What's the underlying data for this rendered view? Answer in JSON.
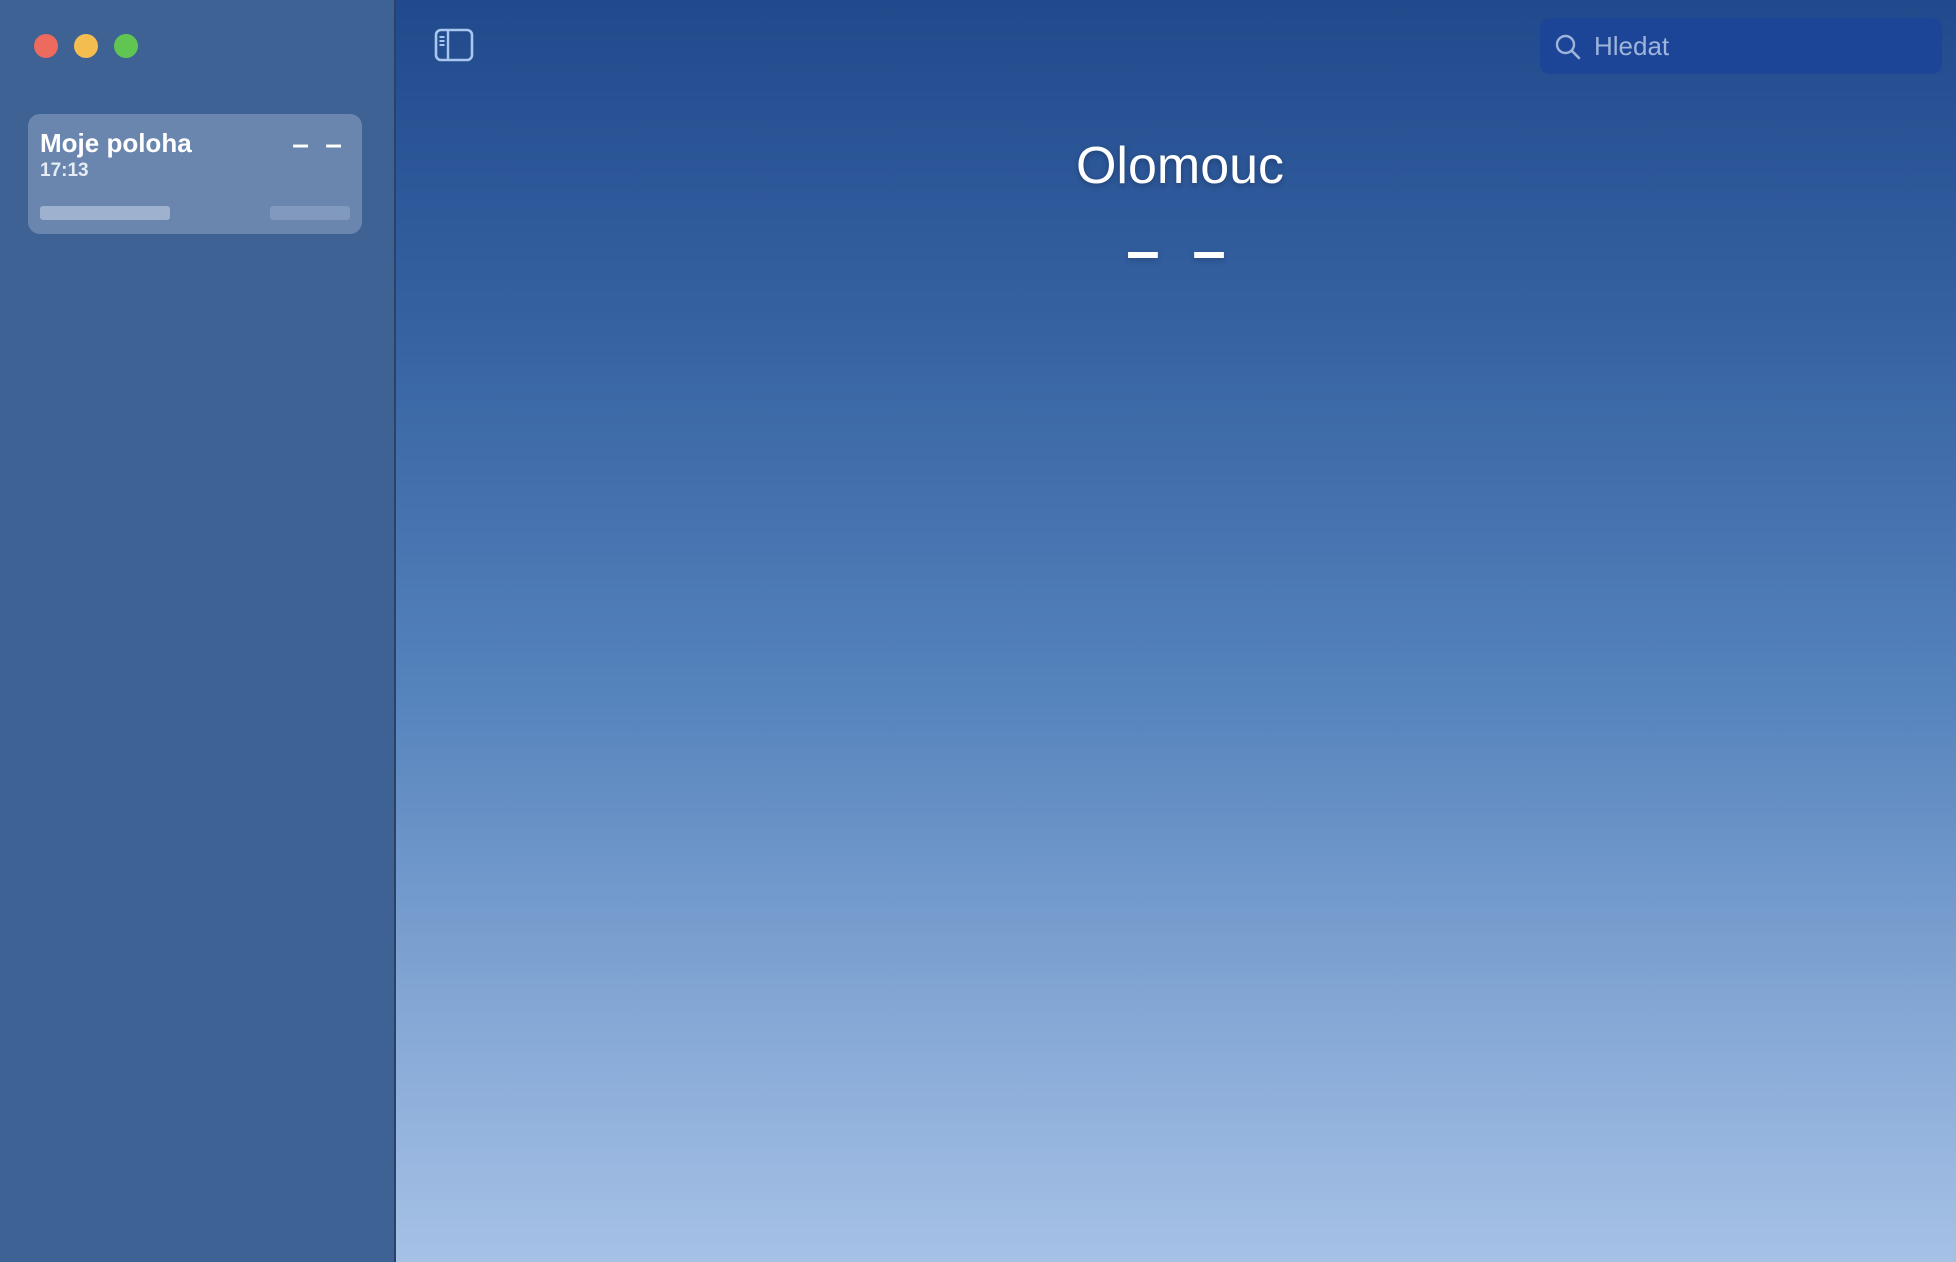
{
  "window": {
    "controls": [
      "close",
      "minimize",
      "zoom"
    ]
  },
  "sidebar": {
    "locations": [
      {
        "name": "Moje poloha",
        "time": "17:13",
        "temperature": "– –"
      }
    ]
  },
  "toolbar": {
    "sidebar_toggle_icon": "sidebar-left-icon",
    "search": {
      "placeholder": "Hledat",
      "value": "",
      "icon": "search-icon"
    }
  },
  "main": {
    "city": "Olomouc",
    "temperature": "– –"
  },
  "colors": {
    "sidebar_bg": "#3f6295",
    "card_bg": "#7d93b5",
    "search_bg": "#1c4597",
    "sky_top": "#214a8c",
    "sky_bottom": "#a6c1e6",
    "close": "#ec6a5e",
    "minimize": "#f3be4f",
    "zoom": "#61c554"
  }
}
